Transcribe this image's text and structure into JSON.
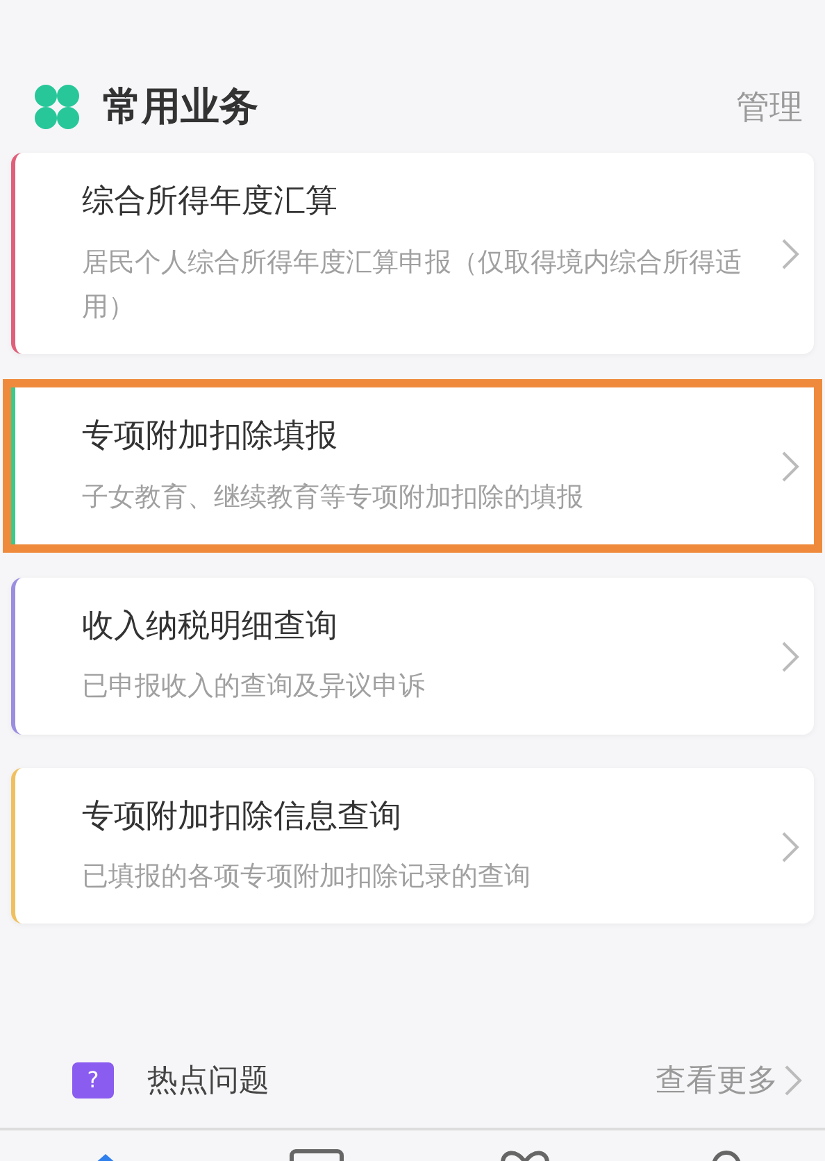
{
  "header": {
    "title": "常用业务",
    "action": "管理"
  },
  "cards": [
    {
      "title": "综合所得年度汇算",
      "subtitle": "居民个人综合所得年度汇算申报（仅取得境内综合所得适用）",
      "color": "#e0607a",
      "highlighted": false
    },
    {
      "title": "专项附加扣除填报",
      "subtitle": "子女教育、继续教育等专项附加扣除的填报",
      "color": "#3cc98a",
      "highlighted": true
    },
    {
      "title": "收入纳税明细查询",
      "subtitle": "已申报收入的查询及异议申诉",
      "color": "#9a8ee0",
      "highlighted": false
    },
    {
      "title": "专项附加扣除信息查询",
      "subtitle": "已填报的各项专项附加扣除记录的查询",
      "color": "#f0c060",
      "highlighted": false
    }
  ],
  "faq": {
    "icon": "?",
    "title": "热点问题",
    "more": "查看更多"
  },
  "tabbar": [
    {
      "selected": true
    },
    {
      "selected": false
    },
    {
      "selected": false
    },
    {
      "selected": false
    }
  ]
}
